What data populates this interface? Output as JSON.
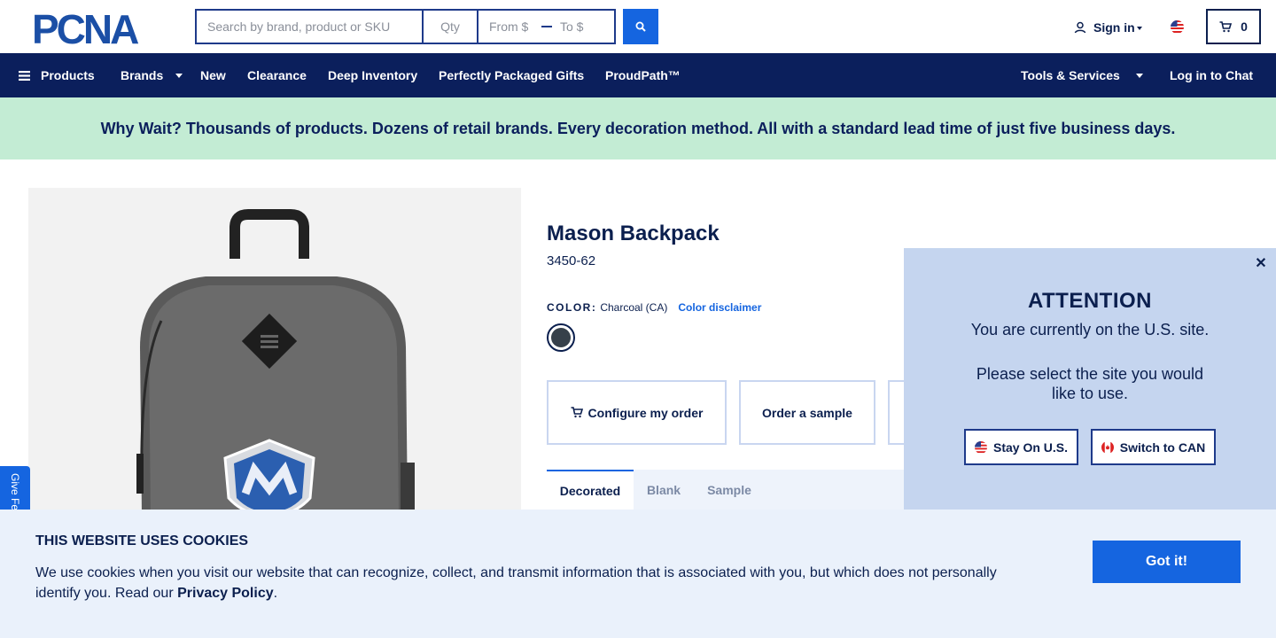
{
  "header": {
    "logo_text": "PCNA",
    "search": {
      "placeholder": "Search by brand, product or SKU",
      "qty_placeholder": "Qty",
      "from_placeholder": "From $",
      "to_placeholder": "To $"
    },
    "signin_label": "Sign in",
    "cart_count": "0"
  },
  "nav": {
    "products": "Products",
    "brands": "Brands",
    "new": "New",
    "clearance": "Clearance",
    "deep_inventory": "Deep Inventory",
    "packaged_gifts": "Perfectly Packaged Gifts",
    "proudpath": "ProudPath™",
    "tools": "Tools & Services",
    "chat": "Log in to Chat"
  },
  "promo": {
    "text": "Why Wait? Thousands of products. Dozens of retail brands. Every decoration method. All with a standard lead time of just five business days."
  },
  "product": {
    "title": "Mason Backpack",
    "sku": "3450-62",
    "color_label": "COLOR:",
    "color_value": "Charcoal (CA)",
    "color_disclaimer": "Color disclaimer",
    "swatch_color": "#36404a",
    "configure_label": "Configure my order",
    "sample_label": "Order a sample",
    "tabs": [
      "Decorated",
      "Blank",
      "Sample"
    ]
  },
  "feedback": {
    "label": "Give Feedback"
  },
  "attention": {
    "title": "ATTENTION",
    "message1": "You are currently on the U.S. site.",
    "message2": "Please select the site you would like to use.",
    "stay_label": "Stay On U.S.",
    "switch_label": "Switch to CAN"
  },
  "cookie": {
    "title": "THIS WEBSITE USES COOKIES",
    "text": "We use cookies when you visit our website that can recognize, collect, and transmit information that is associated with you, but which does not personally identify you. Read our ",
    "link": "Privacy Policy",
    "period": ".",
    "button": "Got it!"
  },
  "colors": {
    "navy": "#0b1f5c",
    "accent_blue": "#1565e0",
    "promo_green": "#c3ecd4",
    "popup_blue": "#c5d5ef",
    "cookie_bg": "#eaf1fb"
  }
}
